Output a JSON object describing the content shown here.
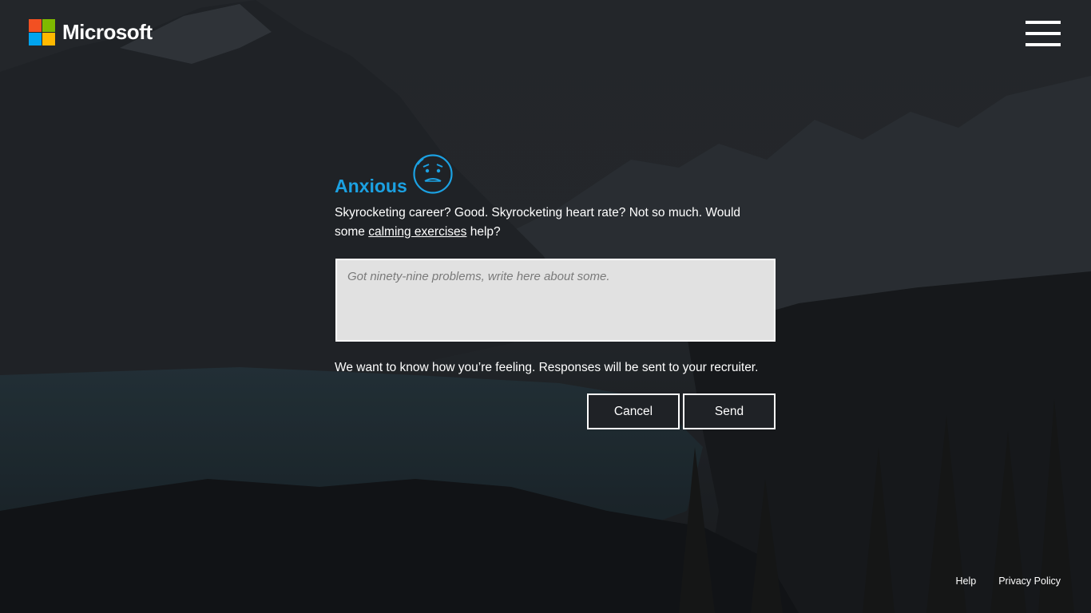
{
  "header": {
    "brand": "Microsoft",
    "logo_colors": [
      "#f25022",
      "#7fba00",
      "#00a4ef",
      "#ffb900"
    ],
    "menu_icon": "hamburger-menu-icon"
  },
  "mood": {
    "title": "Anxious",
    "icon": "anxious-face-icon",
    "accent_color": "#1ba1e2",
    "description_before": "Skyrocketing career? Good. Skyrocketing heart rate? Not so much. Would some ",
    "link_text": "calming exercises",
    "description_after": " help?"
  },
  "form": {
    "placeholder": "Got ninety-nine problems, write here about some.",
    "value": "",
    "notice": "We want to know how you’re feeling. Responses will be sent to your recruiter.",
    "cancel_label": "Cancel",
    "send_label": "Send"
  },
  "footer": {
    "help_label": "Help",
    "privacy_label": "Privacy Policy"
  }
}
